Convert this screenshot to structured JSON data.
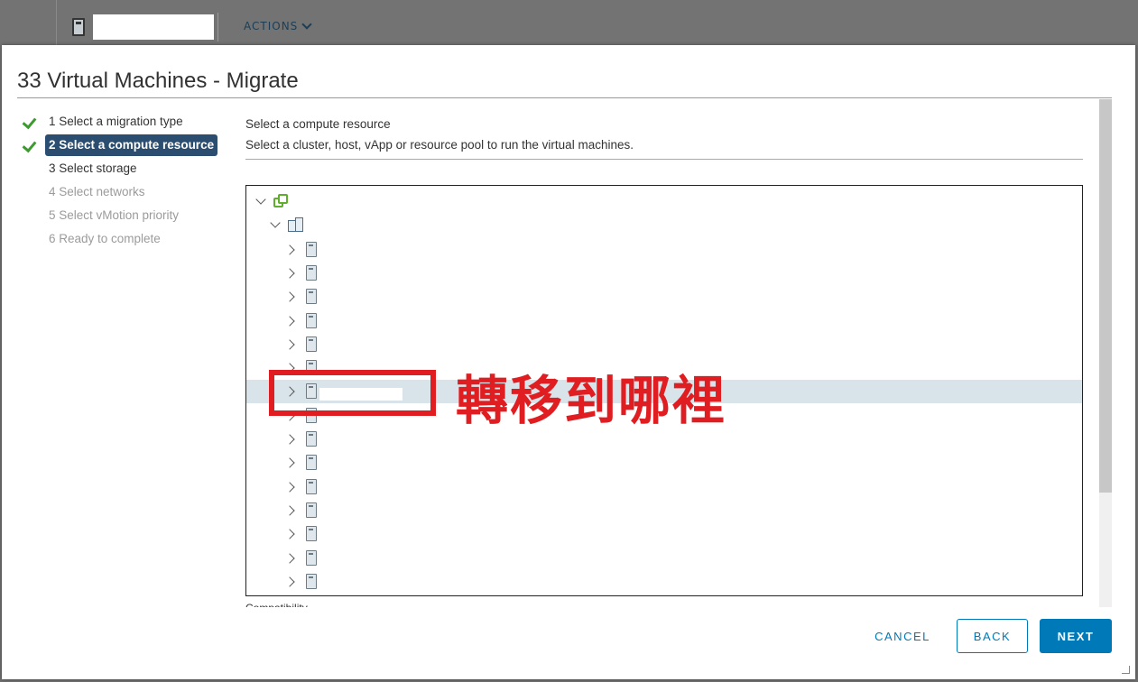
{
  "background": {
    "actions_label": "ACTIONS"
  },
  "dialog": {
    "title": "33 Virtual Machines - Migrate"
  },
  "steps": [
    {
      "label": "1 Select a migration type",
      "state": "done"
    },
    {
      "label": "2 Select a compute resource",
      "state": "active"
    },
    {
      "label": "3 Select storage",
      "state": "pending-next"
    },
    {
      "label": "4 Select networks",
      "state": "disabled"
    },
    {
      "label": "5 Select vMotion priority",
      "state": "disabled"
    },
    {
      "label": "6 Ready to complete",
      "state": "disabled"
    }
  ],
  "content": {
    "title": "Select a compute resource",
    "description": "Select a cluster, host, vApp or resource pool to run the virtual machines.",
    "compatibility_label": "Compatibility"
  },
  "tree": {
    "root_icon": "vcenter-icon",
    "datacenter_icon": "datacenter-icon",
    "host_icon": "host-icon",
    "host_count": 15,
    "selected_host_index": 6
  },
  "annotation": {
    "text": "轉移到哪裡",
    "color": "#e01e22"
  },
  "buttons": {
    "cancel": "CANCEL",
    "back": "BACK",
    "next": "NEXT"
  },
  "colors": {
    "accent": "#0079b8",
    "active_step": "#2b4d70",
    "check": "#3c9a2f",
    "selected_row": "#d9e4ea"
  }
}
